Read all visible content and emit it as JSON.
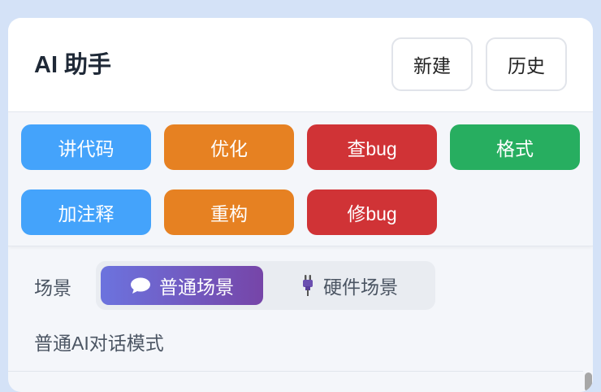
{
  "header": {
    "title": "AI 助手",
    "new_label": "新建",
    "history_label": "历史"
  },
  "actions": [
    {
      "label": "讲代码",
      "color": "#44a3fb"
    },
    {
      "label": "优化",
      "color": "#e68122"
    },
    {
      "label": "查bug",
      "color": "#d03336"
    },
    {
      "label": "格式",
      "color": "#27ae60"
    },
    {
      "label": "加注释",
      "color": "#44a3fb"
    },
    {
      "label": "重构",
      "color": "#e68122"
    },
    {
      "label": "修bug",
      "color": "#d03336"
    }
  ],
  "scene": {
    "label": "场景",
    "options": [
      {
        "label": "普通场景",
        "icon": "chat-bubble-icon",
        "active": true
      },
      {
        "label": "硬件场景",
        "icon": "plug-icon",
        "active": false
      }
    ],
    "description": "普通AI对话模式"
  }
}
